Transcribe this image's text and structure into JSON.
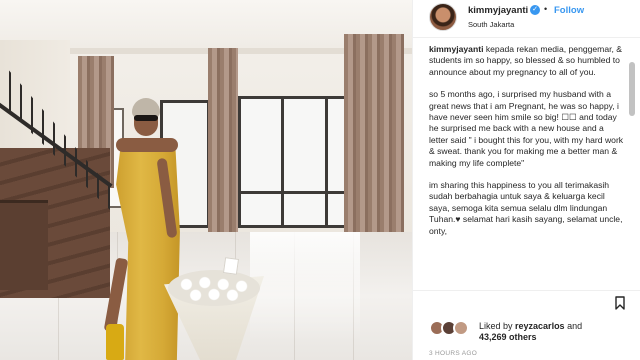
{
  "post": {
    "username": "kimmyjayanti",
    "follow_label": "Follow",
    "location": "South Jakarta",
    "dot": "•",
    "verified_glyph": "✓"
  },
  "caption": {
    "p1_user": "kimmyjayanti",
    "p1_text": " kepada rekan media, penggemar, & students im so happy, so blessed & so humbled to announce about my pregnancy to all of you.",
    "p2": "so 5 months ago, i surprised my husband with a great news that i am Pregnant, he was so happy, i have never seen him smile so big! ☐☐ and today he surprised me back with a new house and a letter said \" i bought this for you, with my hard work & sweat. thank you for making me a better man & making my life complete\"",
    "p3": "im sharing this happiness to you all terimakasih sudah berbahagia untuk saya & keluarga kecil saya, semoga kita semua selalu dlm lindungan Tuhan.♥ selamat hari kasih sayang, selamat uncle, onty,"
  },
  "likes": {
    "prefix": "Liked by ",
    "user": "reyzacarlos",
    "and": " and",
    "count": "43,269 others"
  },
  "timestamp": "3 HOURS AGO",
  "colors": {
    "accent": "#3897f0",
    "text": "#262626",
    "muted": "#999999"
  },
  "icons": [
    "verified-badge-icon",
    "bookmark-icon"
  ]
}
